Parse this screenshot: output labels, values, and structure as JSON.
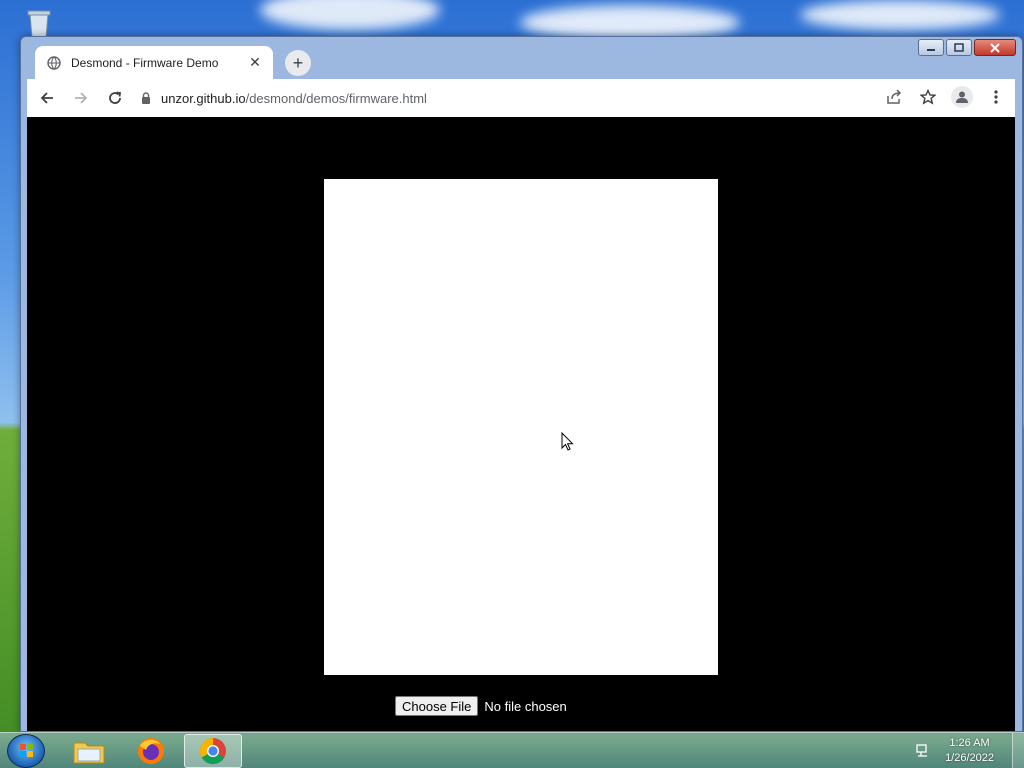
{
  "browser": {
    "tab_title": "Desmond - Firmware Demo",
    "tab_close": "✕",
    "new_tab": "+",
    "url_host": "unzor.github.io",
    "url_path": "/desmond/demos/firmware.html"
  },
  "page": {
    "file_button_label": "Choose File",
    "file_status": "No file chosen"
  },
  "taskbar": {
    "time": "1:26 AM",
    "date": "1/26/2022"
  },
  "colors": {
    "page_background": "#000000",
    "canvas_background": "#ffffff"
  }
}
